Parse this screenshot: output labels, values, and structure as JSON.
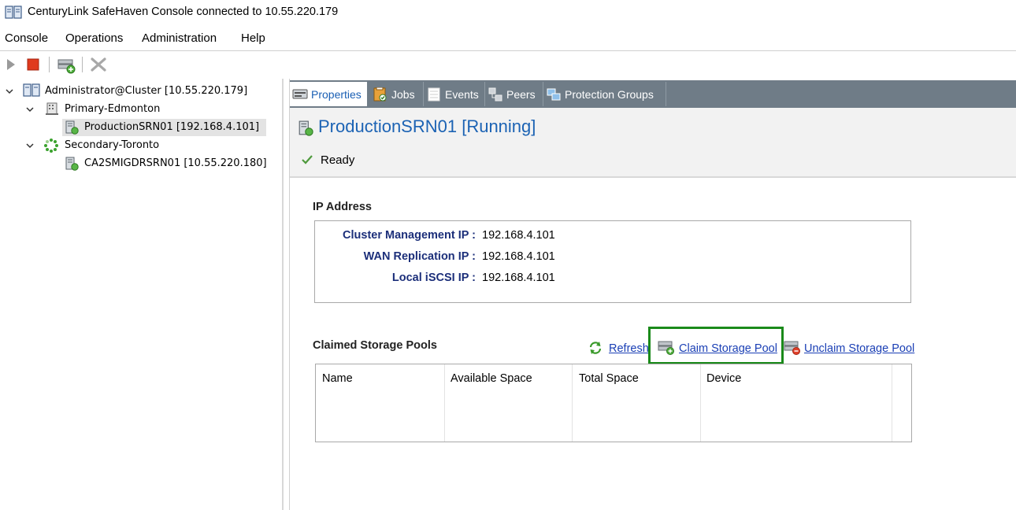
{
  "window": {
    "title": "CenturyLink SafeHaven Console connected to 10.55.220.179"
  },
  "menu": [
    "Console",
    "Operations",
    "Administration",
    "Help"
  ],
  "toolbar": {
    "icons": [
      "play-icon",
      "stop-icon",
      "add-server-icon",
      "remove-icon"
    ]
  },
  "tree": {
    "root": "Administrator@Cluster [10.55.220.179]",
    "sites": [
      {
        "name": "Primary-Edmonton",
        "node": "ProductionSRN01 [192.168.4.101]"
      },
      {
        "name": "Secondary-Toronto",
        "node": "CA2SMIGDRSRN01 [10.55.220.180]"
      }
    ]
  },
  "tabs": [
    "Properties",
    "Jobs",
    "Events",
    "Peers",
    "Protection Groups"
  ],
  "header": {
    "title": "ProductionSRN01 [Running]",
    "status": "Ready"
  },
  "ip_section": {
    "title": "IP Address",
    "rows": [
      {
        "label": "Cluster Management IP :",
        "value": "192.168.4.101"
      },
      {
        "label": "WAN Replication IP :",
        "value": "192.168.4.101"
      },
      {
        "label": "Local iSCSI IP :",
        "value": "192.168.4.101"
      }
    ]
  },
  "storage_section": {
    "title": "Claimed Storage Pools",
    "refresh": "Refresh",
    "claim": "Claim Storage Pool",
    "unclaim": "Unclaim Storage Pool",
    "columns": [
      "Name",
      "Available Space",
      "Total Space",
      "Device"
    ]
  },
  "colors": {
    "accent": "#1c63b4",
    "tabstrip": "#6f7c87",
    "highlight": "#1a8a1a"
  }
}
